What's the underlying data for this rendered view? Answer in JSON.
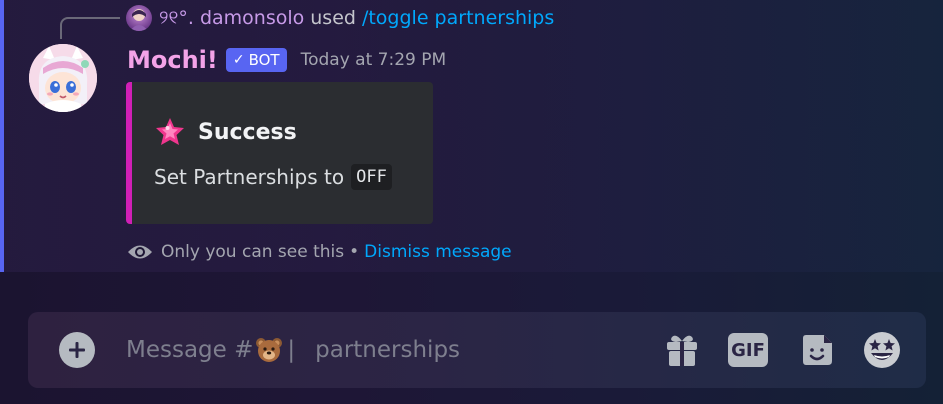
{
  "reply": {
    "username": "୨୧°. damonsolo",
    "used_text": "used",
    "command": "/toggle partnerships"
  },
  "message": {
    "author": "Mochi!",
    "bot_tag": "BOT",
    "timestamp": "Today at 7:29 PM",
    "embed": {
      "accent_color": "#d01fb6",
      "icon": "pink-star-icon",
      "title": "Success",
      "description": "Set Partnerships to",
      "value": "OFF"
    }
  },
  "ephemeral": {
    "text": "Only you can see this",
    "separator": "•",
    "dismiss": "Dismiss message"
  },
  "composer": {
    "placeholder_prefix": "Message #",
    "placeholder_emoji": "bear-face-emoji",
    "channel_name": "partnerships",
    "icons": [
      "plus-icon",
      "gift-icon",
      "gif-icon",
      "sticker-icon",
      "emoji-icon"
    ],
    "gif_label": "GIF"
  },
  "colors": {
    "bot_tag": "#5865f2",
    "link": "#00a8fc",
    "author": "#f3a3e8",
    "reply_name": "#c79ae8"
  }
}
